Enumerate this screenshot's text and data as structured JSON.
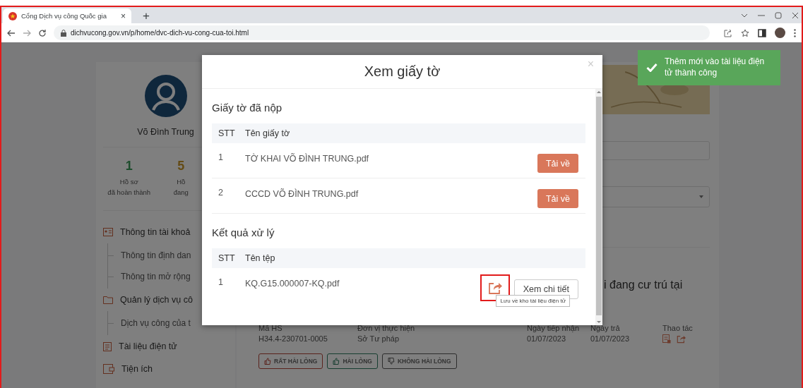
{
  "browser": {
    "tab": {
      "title": "Cổng Dịch vụ công Quốc gia",
      "close": "×"
    },
    "new_tab": "+",
    "url": "dichvucong.gov.vn/p/home/dvc-dich-vu-cong-cua-toi.html"
  },
  "sidebar": {
    "user_name": "Võ Đình Trung",
    "stats": [
      {
        "value": "1",
        "label": [
          "Hồ sơ",
          "đã hoàn thành"
        ],
        "kind": "completed"
      },
      {
        "value": "5",
        "label": [
          "Hồ",
          "đang"
        ],
        "kind": "processing"
      }
    ],
    "menu": [
      {
        "label": "Thông tin tài khoả",
        "kind": "account",
        "children": [
          {
            "label": "Thông tin định dan"
          },
          {
            "label": "Thông tin mở rộng"
          }
        ]
      },
      {
        "label": "Quản lý dịch vụ cô",
        "kind": "folder",
        "children": [
          {
            "label": "Dịch vụ công của t"
          }
        ]
      },
      {
        "label": "Tài liệu điện tử",
        "kind": "document"
      },
      {
        "label": "Tiện ích",
        "kind": "wallet"
      }
    ]
  },
  "main": {
    "heading": "i đang cư trú tại",
    "record": {
      "fields": [
        {
          "label": "Mã HS",
          "value": "H34.4-230701-0005"
        },
        {
          "label": "Đơn vị thực hiện",
          "value": "Sở Tư pháp"
        },
        {
          "label": "Ngày tiếp nhận",
          "value": "01/07/2023"
        },
        {
          "label": "Ngày trả",
          "value": "01/07/2023"
        }
      ],
      "actions_label": "Thao tác",
      "ratings": [
        {
          "label": "RẤT HÀI LÒNG",
          "kind": "very_satisfied"
        },
        {
          "label": "HÀI LÒNG",
          "kind": "satisfied"
        },
        {
          "label": "KHÔNG HÀI LÒNG",
          "kind": "unsatisfied"
        }
      ]
    }
  },
  "modal": {
    "title": "Xem giấy tờ",
    "close": "×",
    "sections": [
      {
        "title": "Giấy tờ đã nộp",
        "columns": [
          "STT",
          "Tên giấy tờ"
        ],
        "rows": [
          {
            "stt": "1",
            "name": "TỜ KHAI VÕ ĐÌNH TRUNG.pdf",
            "kind": "download",
            "button": "Tải về"
          },
          {
            "stt": "2",
            "name": "CCCD VÕ ĐÌNH TRUNG.pdf",
            "kind": "download",
            "button": "Tải về"
          }
        ]
      },
      {
        "title": "Kết quả xử lý",
        "columns": [
          "STT",
          "Tên tệp"
        ],
        "rows": [
          {
            "stt": "1",
            "name": "KQ.G15.000007-KQ.pdf",
            "kind": "result",
            "save": {
              "highlighted": true,
              "tooltip": "Lưu về kho tài liệu điện tử"
            },
            "button": "Xem chi tiết"
          }
        ]
      }
    ]
  },
  "toast": {
    "message": "Thêm mới vào tài liệu điện tử thành công"
  }
}
